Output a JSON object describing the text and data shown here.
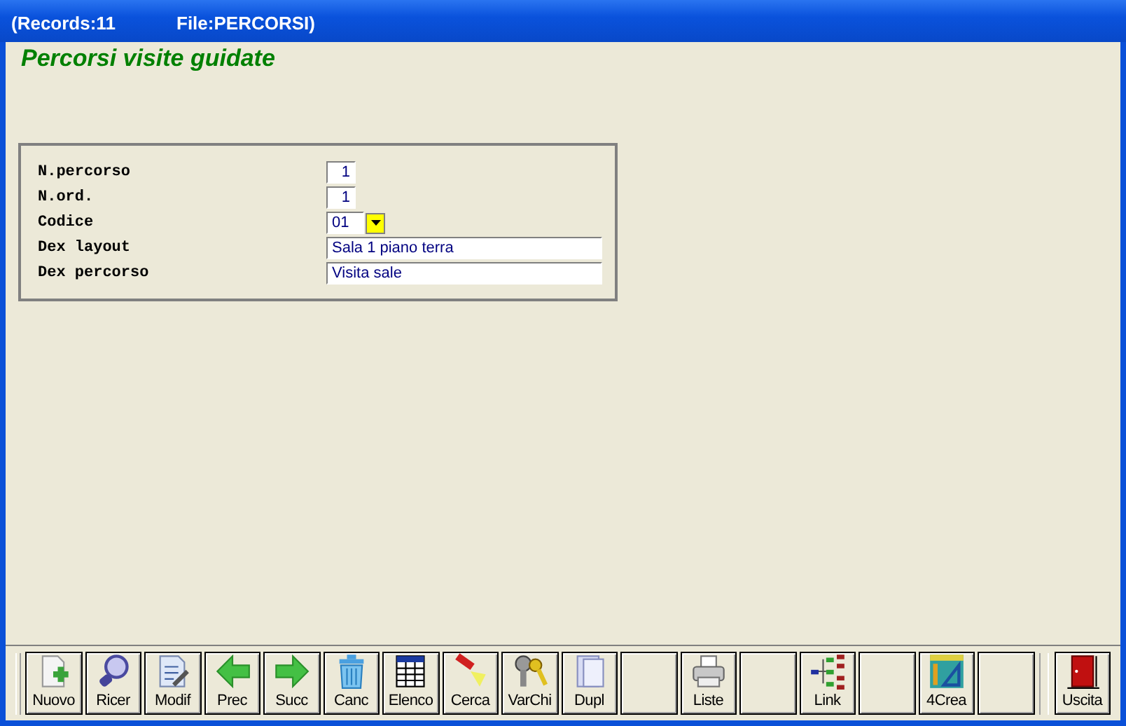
{
  "window": {
    "title_parts": [
      "(Records:11",
      "File:PERCORSI)"
    ]
  },
  "heading": "Percorsi visite guidate",
  "form": {
    "fields": [
      {
        "label": "N.percorso",
        "kind": "number",
        "value": "1"
      },
      {
        "label": "N.ord.",
        "kind": "number",
        "value": "1"
      },
      {
        "label": "Codice",
        "kind": "combo",
        "value": "01"
      },
      {
        "label": "Dex layout",
        "kind": "text",
        "value": "Sala 1 piano terra"
      },
      {
        "label": "Dex percorso",
        "kind": "text",
        "value": "Visita sale"
      }
    ]
  },
  "toolbar": {
    "buttons": [
      {
        "kind": "button",
        "label": "Nuovo"
      },
      {
        "kind": "button",
        "label": "Ricer"
      },
      {
        "kind": "button",
        "label": "Modif"
      },
      {
        "kind": "button",
        "label": "Prec"
      },
      {
        "kind": "button",
        "label": "Succ"
      },
      {
        "kind": "button",
        "label": "Canc"
      },
      {
        "kind": "button",
        "label": "Elenco"
      },
      {
        "kind": "button",
        "label": "Cerca"
      },
      {
        "kind": "button",
        "label": "VarChi"
      },
      {
        "kind": "button",
        "label": "Dupl"
      },
      {
        "kind": "blank"
      },
      {
        "kind": "button",
        "label": "Liste"
      },
      {
        "kind": "blank"
      },
      {
        "kind": "button",
        "label": "Link"
      },
      {
        "kind": "blank"
      },
      {
        "kind": "button",
        "label": "4Crea"
      },
      {
        "kind": "blank"
      }
    ],
    "exit_button": {
      "label": "Uscita"
    }
  }
}
